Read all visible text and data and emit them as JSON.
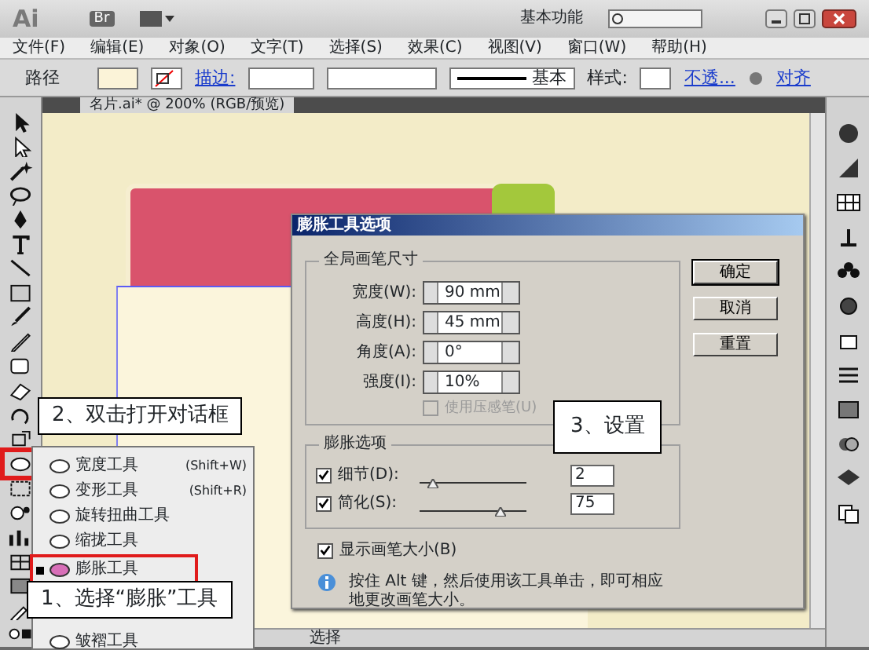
{
  "app_bar": {
    "logo": "Ai",
    "bridge": "Br",
    "workspace": "基本功能"
  },
  "menu": [
    "文件(F)",
    "编辑(E)",
    "对象(O)",
    "文字(T)",
    "选择(S)",
    "效果(C)",
    "视图(V)",
    "窗口(W)",
    "帮助(H)"
  ],
  "control_bar": {
    "object_type": "路径",
    "stroke_link": "描边:",
    "brush": "基本",
    "style_label": "样式:",
    "opacity_link": "不透...",
    "align_link": "对齐"
  },
  "document_tab": {
    "title": "名片.ai* @ 200% (RGB/预览)"
  },
  "tool_flyout": [
    {
      "label": "宽度工具",
      "shortcut": "(Shift+W)",
      "selected": false
    },
    {
      "label": "变形工具",
      "shortcut": "(Shift+R)",
      "selected": false
    },
    {
      "label": "旋转扭曲工具",
      "selected": false
    },
    {
      "label": "缩拢工具",
      "selected": false
    },
    {
      "label": "膨胀工具",
      "selected": true
    },
    {
      "label": "皱褶工具",
      "selected": false
    }
  ],
  "callouts": [
    {
      "text": "2、双击打开对话框"
    },
    {
      "text": "1、选择“膨胀”工具"
    },
    {
      "text": "3、设置"
    }
  ],
  "dialog": {
    "title": "膨胀工具选项",
    "brush_group": {
      "title": "全局画笔尺寸",
      "fields": [
        {
          "label": "宽度(W):",
          "value": "90 mm"
        },
        {
          "label": "高度(H):",
          "value": "45 mm"
        },
        {
          "label": "角度(A):",
          "value": "0°"
        },
        {
          "label": "强度(I):",
          "value": "10%"
        }
      ],
      "pressure": {
        "label": "使用压感笔(U)",
        "checked": false,
        "disabled": true
      }
    },
    "options_group": {
      "title": "膨胀选项",
      "sliders": [
        {
          "label": "细节(D):",
          "checked": true,
          "level": 0.12,
          "value": "2"
        },
        {
          "label": "简化(S):",
          "checked": true,
          "level": 0.75,
          "value": "75"
        }
      ]
    },
    "show_brush_size": {
      "label": "显示画笔大小(B)",
      "checked": true
    },
    "hint": "按住 Alt 键，然后使用该工具单击，即可相应地更改画笔大小。",
    "buttons": [
      {
        "label": "确定",
        "default": true
      },
      {
        "label": "取消",
        "default": false
      },
      {
        "label": "重置",
        "default": false
      }
    ]
  },
  "status_bar": {
    "tool": "选择"
  }
}
